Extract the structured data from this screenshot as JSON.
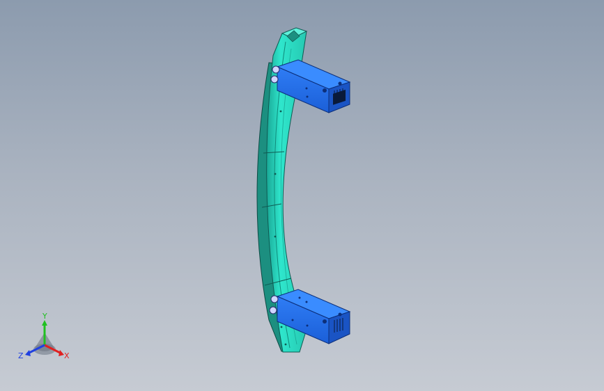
{
  "viewport": {
    "background_top": "#8c9bae",
    "background_bottom": "#c6cbd3",
    "model": {
      "rail_color": "#2ee0c6",
      "bracket_color": "#1e6cf0",
      "bracket_count": 2
    }
  },
  "triad": {
    "x_label": "X",
    "y_label": "Y",
    "z_label": "Z",
    "x_color": "#e02020",
    "y_color": "#20c020",
    "z_color": "#2040e0"
  }
}
